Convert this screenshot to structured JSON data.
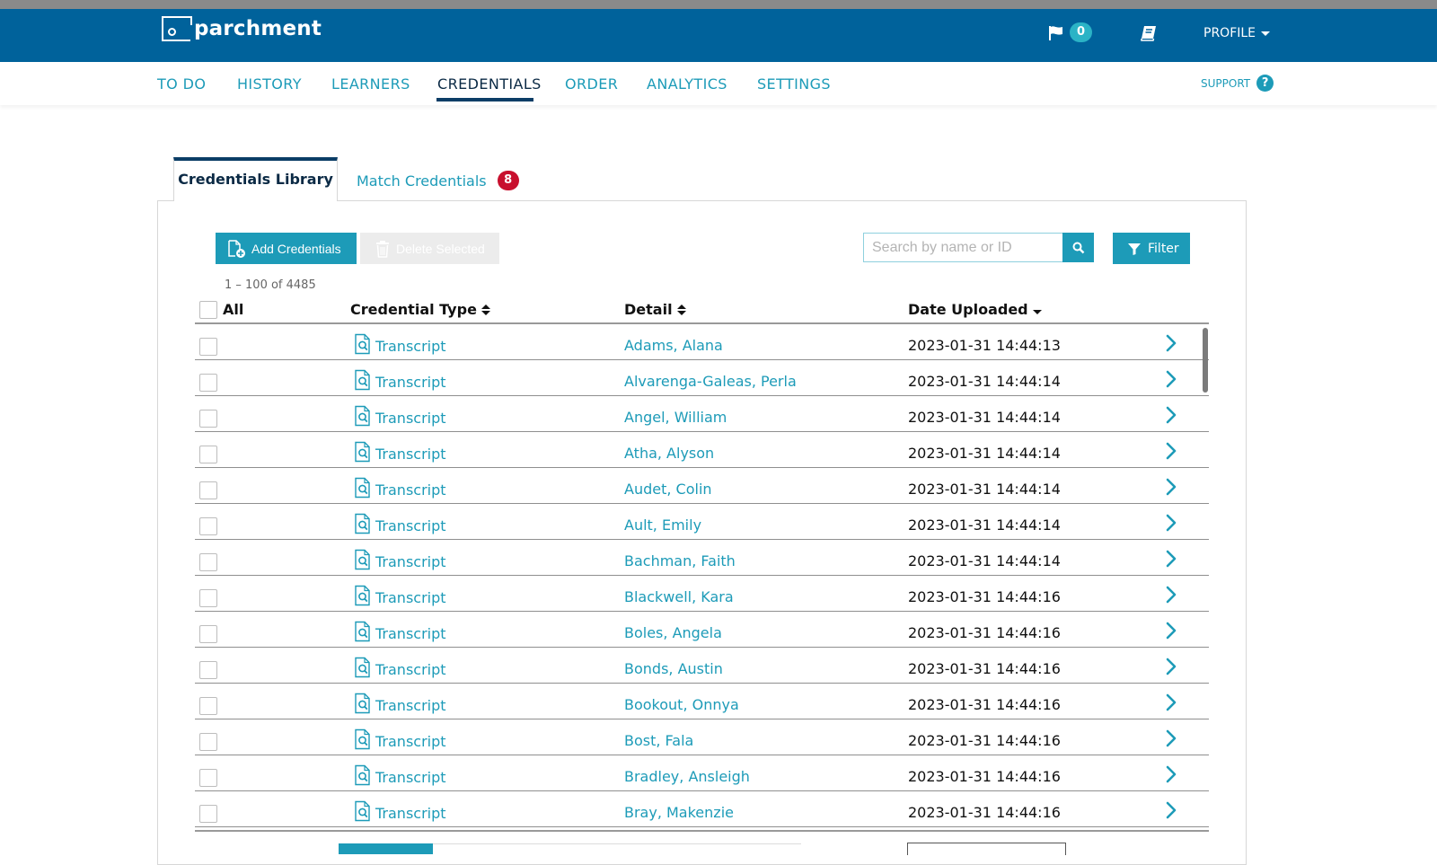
{
  "app": {
    "logo_text": "parchment",
    "notification_count": "0",
    "profile_label": "PROFILE"
  },
  "nav": {
    "items": [
      {
        "label": "TO DO"
      },
      {
        "label": "HISTORY"
      },
      {
        "label": "LEARNERS"
      },
      {
        "label": "CREDENTIALS",
        "active": true
      },
      {
        "label": "ORDER"
      },
      {
        "label": "ANALYTICS"
      },
      {
        "label": "SETTINGS"
      }
    ],
    "support_label": "SUPPORT",
    "support_icon_glyph": "?"
  },
  "tabs": {
    "library_label": "Credentials Library",
    "match_label": "Match Credentials",
    "match_count": "8"
  },
  "toolbar": {
    "add_label": "Add Credentials",
    "delete_label": "Delete Selected",
    "search_placeholder": "Search by name or ID",
    "filter_label": "Filter",
    "range_text": "1 – 100 of 4485"
  },
  "table": {
    "columns": {
      "all": "All",
      "credential_type": "Credential Type",
      "detail": "Detail",
      "date_uploaded": "Date Uploaded"
    },
    "rows": [
      {
        "type": "Transcript",
        "detail": "Adams, Alana",
        "date": "2023-01-31 14:44:13"
      },
      {
        "type": "Transcript",
        "detail": "Alvarenga-Galeas, Perla",
        "date": "2023-01-31 14:44:14"
      },
      {
        "type": "Transcript",
        "detail": "Angel, William",
        "date": "2023-01-31 14:44:14"
      },
      {
        "type": "Transcript",
        "detail": "Atha, Alyson",
        "date": "2023-01-31 14:44:14"
      },
      {
        "type": "Transcript",
        "detail": "Audet, Colin",
        "date": "2023-01-31 14:44:14"
      },
      {
        "type": "Transcript",
        "detail": "Ault, Emily",
        "date": "2023-01-31 14:44:14"
      },
      {
        "type": "Transcript",
        "detail": "Bachman, Faith",
        "date": "2023-01-31 14:44:14"
      },
      {
        "type": "Transcript",
        "detail": "Blackwell, Kara",
        "date": "2023-01-31 14:44:16"
      },
      {
        "type": "Transcript",
        "detail": "Boles, Angela",
        "date": "2023-01-31 14:44:16"
      },
      {
        "type": "Transcript",
        "detail": "Bonds, Austin",
        "date": "2023-01-31 14:44:16"
      },
      {
        "type": "Transcript",
        "detail": "Bookout, Onnya",
        "date": "2023-01-31 14:44:16"
      },
      {
        "type": "Transcript",
        "detail": "Bost, Fala",
        "date": "2023-01-31 14:44:16"
      },
      {
        "type": "Transcript",
        "detail": "Bradley, Ansleigh",
        "date": "2023-01-31 14:44:16"
      },
      {
        "type": "Transcript",
        "detail": "Bray, Makenzie",
        "date": "2023-01-31 14:44:16"
      }
    ]
  },
  "colors": {
    "header_bg": "#00629b",
    "accent": "#1d9bb8",
    "badge_red": "#c8102e",
    "nav_active": "#0b2a45"
  },
  "icons": {
    "flag": "flag-icon",
    "book": "book-icon",
    "add_doc": "add-document-icon",
    "trash": "trash-icon",
    "search": "search-icon",
    "filter": "filter-icon",
    "transcript": "document-search-icon",
    "chevron": "chevron-right-icon"
  }
}
